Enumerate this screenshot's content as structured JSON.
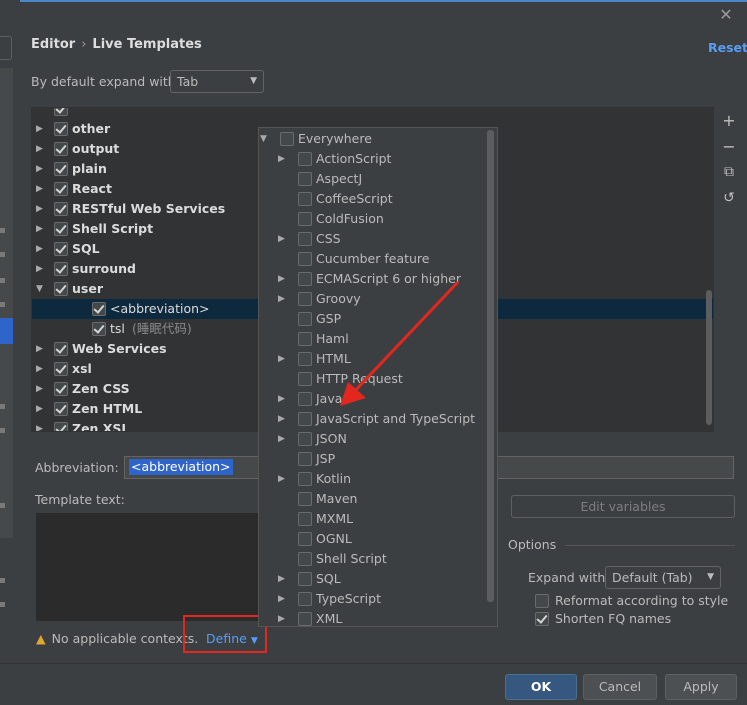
{
  "header": {
    "crumb1": "Editor",
    "sep": "›",
    "crumb2": "Live Templates",
    "reset": "Reset",
    "close": "✕"
  },
  "expand": {
    "label": "By default expand with",
    "value": "Tab"
  },
  "tree": {
    "rows": [
      {
        "label": "other",
        "checked": true,
        "expandable": true
      },
      {
        "label": "output",
        "checked": true,
        "expandable": true
      },
      {
        "label": "plain",
        "checked": true,
        "expandable": true
      },
      {
        "label": "React",
        "checked": true,
        "expandable": true
      },
      {
        "label": "RESTful Web Services",
        "checked": true,
        "expandable": true
      },
      {
        "label": "Shell Script",
        "checked": true,
        "expandable": true
      },
      {
        "label": "SQL",
        "checked": true,
        "expandable": true
      },
      {
        "label": "surround",
        "checked": true,
        "expandable": true
      },
      {
        "label": "user",
        "checked": true,
        "expandable": true,
        "expanded": true
      },
      {
        "label": "<abbreviation>",
        "checked": true,
        "child": true,
        "selected": true
      },
      {
        "label": "tsl",
        "sub": "(睡眠代码)",
        "checked": true,
        "child": true
      },
      {
        "label": "Web Services",
        "checked": true,
        "expandable": true
      },
      {
        "label": "xsl",
        "checked": true,
        "expandable": true
      },
      {
        "label": "Zen CSS",
        "checked": true,
        "expandable": true
      },
      {
        "label": "Zen HTML",
        "checked": true,
        "expandable": true
      },
      {
        "label": "Zen XSL",
        "checked": true,
        "expandable": true
      }
    ]
  },
  "toolbar": {
    "add": "+",
    "remove": "−",
    "copy": "⧉",
    "restore": "↺"
  },
  "abbreviation": {
    "label": "Abbreviation:",
    "value": "<abbreviation>"
  },
  "template": {
    "label": "Template text:"
  },
  "context": {
    "warning": "No applicable contexts.",
    "define": "Define"
  },
  "editvars": {
    "label": "Edit variables"
  },
  "options": {
    "title": "Options",
    "expand_label": "Expand with",
    "expand_value": "Default (Tab)",
    "reformat": "Reformat according to style",
    "shorten": "Shorten FQ names",
    "reformat_checked": false,
    "shorten_checked": true
  },
  "buttons": {
    "ok": "OK",
    "cancel": "Cancel",
    "apply": "Apply"
  },
  "popup": {
    "root": "Everywhere",
    "items": [
      {
        "label": "ActionScript",
        "expandable": true
      },
      {
        "label": "AspectJ",
        "expandable": false
      },
      {
        "label": "CoffeeScript",
        "expandable": false
      },
      {
        "label": "ColdFusion",
        "expandable": false
      },
      {
        "label": "CSS",
        "expandable": true
      },
      {
        "label": "Cucumber feature",
        "expandable": false
      },
      {
        "label": "ECMAScript 6 or higher",
        "expandable": true
      },
      {
        "label": "Groovy",
        "expandable": true
      },
      {
        "label": "GSP",
        "expandable": false
      },
      {
        "label": "Haml",
        "expandable": false
      },
      {
        "label": "HTML",
        "expandable": true
      },
      {
        "label": "HTTP Request",
        "expandable": false
      },
      {
        "label": "Java",
        "expandable": true
      },
      {
        "label": "JavaScript and TypeScript",
        "expandable": true
      },
      {
        "label": "JSON",
        "expandable": true
      },
      {
        "label": "JSP",
        "expandable": false
      },
      {
        "label": "Kotlin",
        "expandable": true
      },
      {
        "label": "Maven",
        "expandable": false
      },
      {
        "label": "MXML",
        "expandable": false
      },
      {
        "label": "OGNL",
        "expandable": false
      },
      {
        "label": "Shell Script",
        "expandable": false
      },
      {
        "label": "SQL",
        "expandable": true
      },
      {
        "label": "TypeScript",
        "expandable": true
      },
      {
        "label": "XML",
        "expandable": true
      }
    ]
  },
  "colors": {
    "accent": "#589df6",
    "annotation": "#e3271e",
    "selection": "#2f65ca"
  }
}
